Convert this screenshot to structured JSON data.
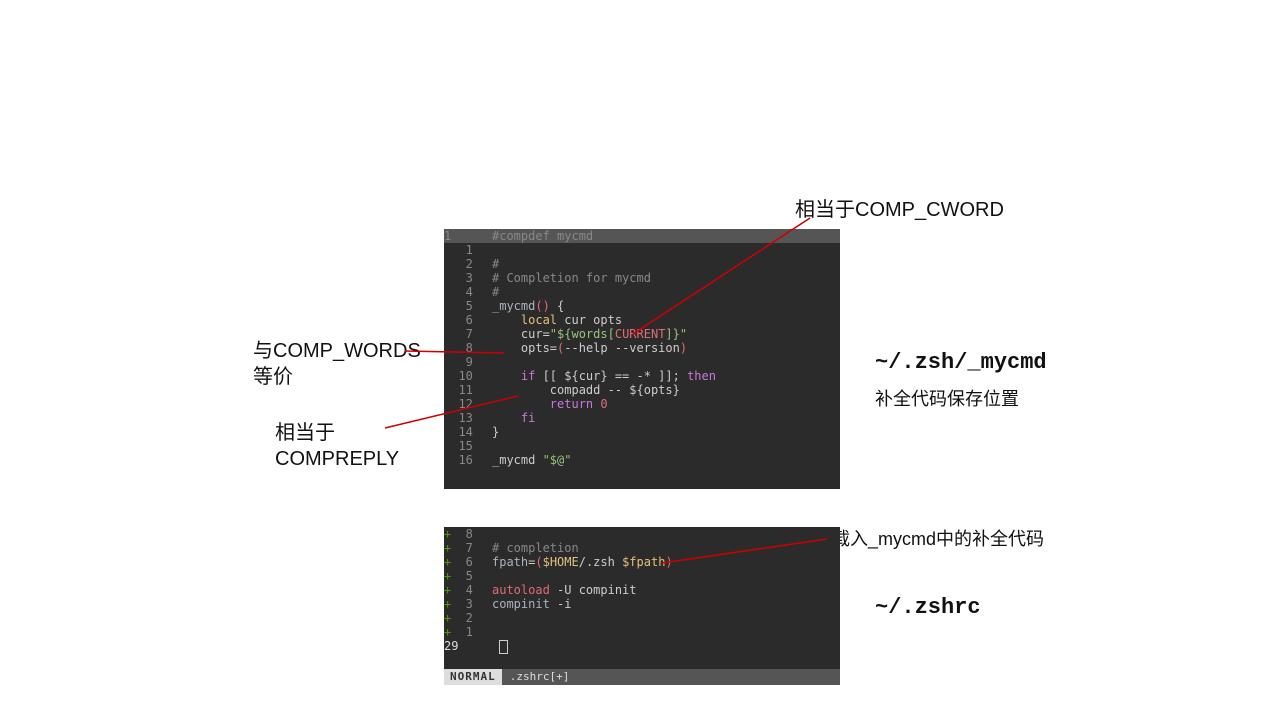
{
  "annotations": {
    "top_right": "相当于COMP_CWORD",
    "left_top_l1": "与COMP_WORDS",
    "left_top_l2": "等价",
    "left_bot_l1": "相当于",
    "left_bot_l2": "COMPREPLY",
    "load_note": "载入_mycmd中的补全代码"
  },
  "paths": {
    "mycmd": "~/.zsh/_mycmd",
    "mycmd_note": "补全代码保存位置",
    "zshrc": "~/.zshrc"
  },
  "editor1": {
    "l1_a": "#",
    "l1_b": "compdef mycmd",
    "l3": "#",
    "l4": "# Completion for mycmd",
    "l5": "#",
    "l6_fn": "_mycmd",
    "l6_paren": "()",
    "l6_brace": " {",
    "l7_kw": "local",
    "l7_rest": " cur opts",
    "l8_pre": "    cur=",
    "l8_str_a": "\"${",
    "l8_str_b": "words",
    "l8_str_c": "[",
    "l8_str_d": "CURRENT",
    "l8_str_e": "]}\"",
    "l9_pre": "    opts=",
    "l9_p1": "(",
    "l9_mid": "--help --version",
    "l9_p2": ")",
    "l11_if": "if",
    "l11_mid": " [[ ${cur} == -* ]]; ",
    "l11_then": "then",
    "l12": "        compadd -- ${opts}",
    "l13_ret": "return",
    "l13_val": " 0",
    "l14_fi": "fi",
    "l15": "}",
    "l17_cmd": "_mycmd ",
    "l17_arg": "\"$@\""
  },
  "editor2": {
    "l8": "",
    "l7": "# completion",
    "l6_a": "fpath",
    "l6_eq": "=",
    "l6_p1": "(",
    "l6_home": "$HOME",
    "l6_mid": "/.zsh ",
    "l6_fpath": "$fpath",
    "l6_p2": ")",
    "l5": "",
    "l4_a": "autoload",
    "l4_b": " -U compinit",
    "l3_a": "compinit",
    "l3_b": " -i",
    "l2": "",
    "l1": "",
    "cursor_line": "29",
    "mode": "NORMAL",
    "filename": ".zshrc[+]"
  }
}
